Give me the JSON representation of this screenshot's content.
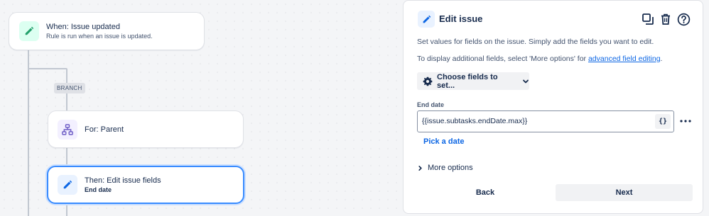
{
  "canvas": {
    "trigger": {
      "title": "When: Issue updated",
      "subtitle": "Rule is run when an issue is updated."
    },
    "branch_tag": "BRANCH",
    "branch_node": {
      "title": "For: Parent"
    },
    "action_node": {
      "title": "Then: Edit issue fields",
      "subtitle": "End date"
    }
  },
  "panel": {
    "title": "Edit issue",
    "description_1": "Set values for fields on the issue. Simply add the fields you want to edit.",
    "description_2_prefix": "To display additional fields, select 'More options' for ",
    "description_2_link": "advanced field editing",
    "description_2_suffix": ".",
    "choose_fields_label": "Choose fields to set...",
    "field": {
      "label": "End date",
      "value": "{{issue.subtasks.endDate.max}}",
      "smart_value_button": "{}"
    },
    "pick_date_label": "Pick a date",
    "more_options_label": "More options",
    "back_label": "Back",
    "next_label": "Next"
  },
  "icons": {
    "trigger": "pencil-icon",
    "branch": "hierarchy-icon",
    "action": "pencil-icon",
    "panel": "pencil-icon",
    "duplicate": "duplicate-icon",
    "delete": "trash-icon",
    "help": "help-icon",
    "gear": "gear-icon",
    "chevron": "chevron-down-icon",
    "more": "more-horizontal-icon",
    "expand": "chevron-right-icon"
  },
  "colors": {
    "trigger_icon_bg": "#dcfff1",
    "trigger_icon_fg": "#22a06b",
    "branch_icon_bg": "#f3f0ff",
    "branch_icon_fg": "#6e5dc6",
    "action_icon_bg": "#e9f2ff",
    "action_icon_fg": "#0c66e4",
    "selected_border": "#388bff",
    "link": "#0c66e4"
  }
}
